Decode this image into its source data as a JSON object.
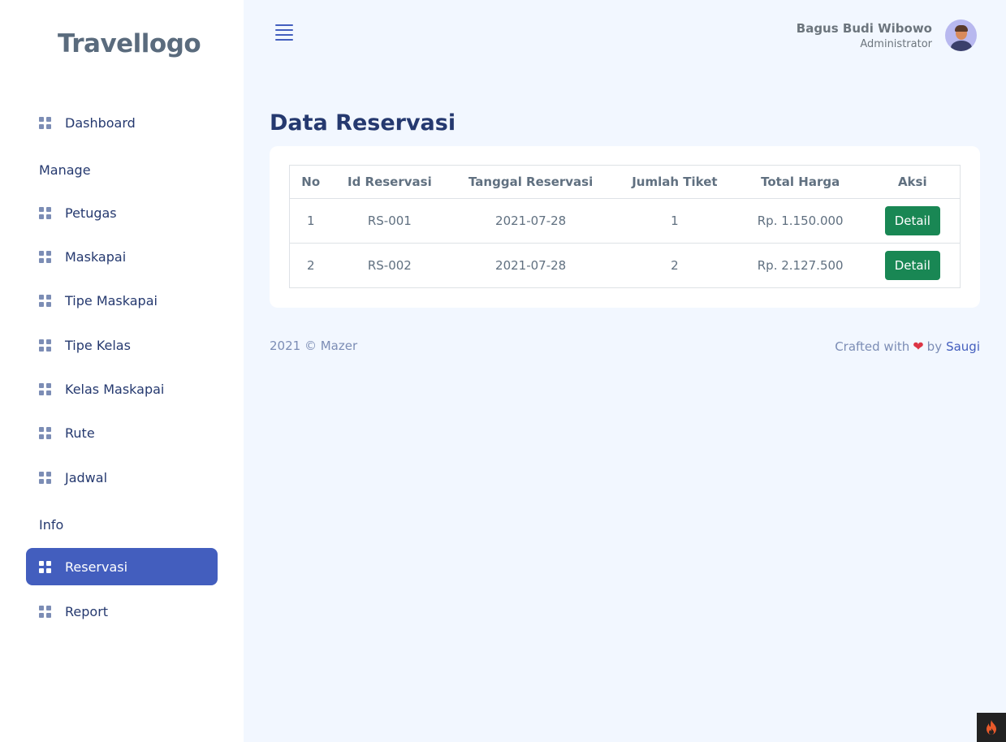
{
  "sidebar": {
    "logo": "Travellogo",
    "dashboard": "Dashboard",
    "manage_title": "Manage",
    "manage_items": [
      "Petugas",
      "Maskapai",
      "Tipe Maskapai",
      "Tipe Kelas",
      "Kelas Maskapai",
      "Rute",
      "Jadwal"
    ],
    "info_title": "Info",
    "info_items": [
      "Reservasi",
      "Report"
    ],
    "active_item": "Reservasi",
    "icon": "grid-icon"
  },
  "header": {
    "menu_icon": "hamburger-icon",
    "user_name": "Bagus Budi Wibowo",
    "user_role": "Administrator"
  },
  "main": {
    "title": "Data Reservasi",
    "columns": [
      "No",
      "Id Reservasi",
      "Tanggal Reservasi",
      "Jumlah Tiket",
      "Total Harga",
      "Aksi"
    ],
    "rows": [
      {
        "no": "1",
        "id": "RS-001",
        "tanggal": "2021-07-28",
        "jumlah": "1",
        "total": "Rp. 1.150.000",
        "action": "Detail"
      },
      {
        "no": "2",
        "id": "RS-002",
        "tanggal": "2021-07-28",
        "jumlah": "2",
        "total": "Rp. 2.127.500",
        "action": "Detail"
      }
    ]
  },
  "footer": {
    "left": "2021 © Mazer",
    "crafted": "Crafted with",
    "by": "by",
    "author": "Saugi"
  },
  "colors": {
    "primary": "#435ebe",
    "success": "#198754",
    "background": "#f2f7ff",
    "heart": "#dc3545"
  }
}
